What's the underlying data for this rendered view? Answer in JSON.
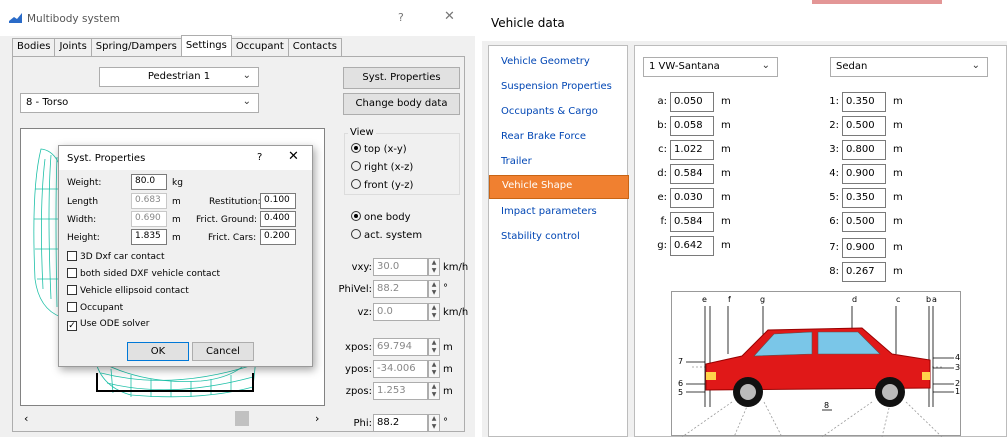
{
  "left_window": {
    "title": "Multibody system",
    "help": "?",
    "close": "✕",
    "tabs": [
      "Bodies",
      "Joints",
      "Spring/Dampers",
      "Settings",
      "Occupant",
      "Contacts"
    ],
    "active_tab": "Settings",
    "object_select": "Pedestrian 1",
    "body_select": "8 - Torso",
    "syst_properties_button": "Syst. Properties",
    "change_body_button": "Change body data",
    "view": {
      "label": "View",
      "options": [
        "top (x-y)",
        "right (x-z)",
        "front (y-z)"
      ],
      "selected": "top (x-y)"
    },
    "mode": {
      "options": [
        "one body",
        "act. system"
      ],
      "selected": "one body"
    },
    "fields": {
      "vxy": {
        "label": "vxy:",
        "value": "30.0",
        "unit": "km/h"
      },
      "phivel": {
        "label": "PhiVel:",
        "value": "88.2",
        "unit": "°"
      },
      "vz": {
        "label": "vz:",
        "value": "0.0",
        "unit": "km/h"
      },
      "xpos": {
        "label": "xpos:",
        "value": "69.794",
        "unit": "m"
      },
      "ypos": {
        "label": "ypos:",
        "value": "-34.006",
        "unit": "m"
      },
      "zpos": {
        "label": "zpos:",
        "value": "1.253",
        "unit": "m"
      },
      "phi": {
        "label": "Phi:",
        "value": "88.2",
        "unit": "°"
      }
    },
    "popup": {
      "title": "Syst. Properties",
      "help": "?",
      "close": "✕",
      "weight": {
        "label": "Weight:",
        "value": "80.0",
        "unit": "kg"
      },
      "length": {
        "label": "Length",
        "value": "0.683",
        "unit": "m"
      },
      "width": {
        "label": "Width:",
        "value": "0.690",
        "unit": "m"
      },
      "height": {
        "label": "Height:",
        "value": "1.835",
        "unit": "m"
      },
      "restitution": {
        "label": "Restitution:",
        "value": "0.100"
      },
      "frict_ground": {
        "label": "Frict. Ground:",
        "value": "0.400"
      },
      "frict_cars": {
        "label": "Frict. Cars:",
        "value": "0.200"
      },
      "checks": [
        {
          "label": "3D Dxf car contact",
          "checked": false
        },
        {
          "label": "both sided DXF vehicle contact",
          "checked": false
        },
        {
          "label": "Vehicle ellipsoid contact",
          "checked": false
        },
        {
          "label": "Occupant",
          "checked": false
        },
        {
          "label": "Use ODE solver",
          "checked": true
        }
      ],
      "ok": "OK",
      "cancel": "Cancel"
    }
  },
  "right_window": {
    "title": "Vehicle data",
    "nav": [
      "Vehicle Geometry",
      "Suspension Properties",
      "Occupants & Cargo",
      "Rear Brake Force",
      "Trailer",
      "Vehicle Shape",
      "Impact parameters",
      "Stability control"
    ],
    "nav_selected": "Vehicle Shape",
    "vehicle_select": "1 VW-Santana",
    "body_type_select": "Sedan",
    "left_params": [
      {
        "label": "a:",
        "value": "0.050",
        "unit": "m"
      },
      {
        "label": "b:",
        "value": "0.058",
        "unit": "m"
      },
      {
        "label": "c:",
        "value": "1.022",
        "unit": "m"
      },
      {
        "label": "d:",
        "value": "0.584",
        "unit": "m"
      },
      {
        "label": "e:",
        "value": "0.030",
        "unit": "m"
      },
      {
        "label": "f:",
        "value": "0.584",
        "unit": "m"
      },
      {
        "label": "g:",
        "value": "0.642",
        "unit": "m"
      }
    ],
    "right_params": [
      {
        "label": "1:",
        "value": "0.350",
        "unit": "m"
      },
      {
        "label": "2:",
        "value": "0.500",
        "unit": "m"
      },
      {
        "label": "3:",
        "value": "0.800",
        "unit": "m"
      },
      {
        "label": "4:",
        "value": "0.900",
        "unit": "m"
      },
      {
        "label": "5:",
        "value": "0.350",
        "unit": "m"
      },
      {
        "label": "6:",
        "value": "0.500",
        "unit": "m"
      },
      {
        "label": "7:",
        "value": "0.900",
        "unit": "m"
      },
      {
        "label": "8:",
        "value": "0.267",
        "unit": "m"
      }
    ],
    "diagram_letters": [
      "e",
      "f",
      "g",
      "d",
      "c",
      "b",
      "a"
    ],
    "diagram_numbers": [
      "7",
      "6",
      "5",
      "4",
      "3",
      "2",
      "1",
      "8"
    ],
    "colors": {
      "car_body": "#e01818",
      "nav_selected": "#f08030",
      "nav_link": "#0046b4"
    }
  }
}
